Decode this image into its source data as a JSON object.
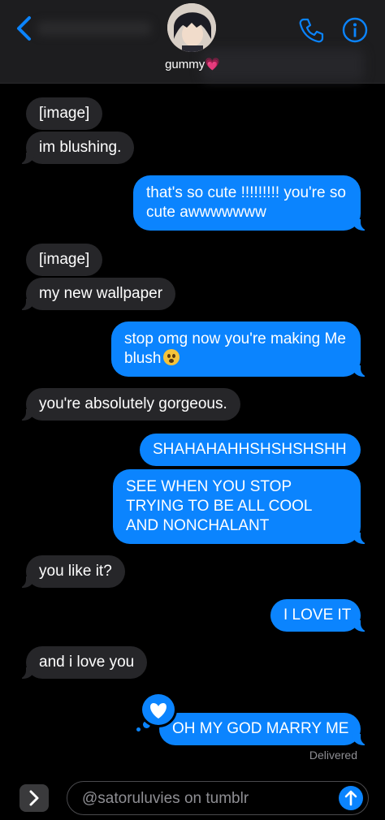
{
  "header": {
    "contact_name": "gummy",
    "contact_emoji": "💗"
  },
  "messages": [
    {
      "side": "in",
      "text": "[image]"
    },
    {
      "side": "in",
      "text": "im blushing."
    },
    {
      "side": "out",
      "text": "that's so cute !!!!!!!!! you're so cute awwwwwww"
    },
    {
      "side": "in",
      "text": "[image]"
    },
    {
      "side": "in",
      "text": "my new wallpaper"
    },
    {
      "side": "out",
      "text": "stop omg now you're making Me blush",
      "emoji": "flushed-face"
    },
    {
      "side": "in",
      "text": "you're absolutely gorgeous."
    },
    {
      "side": "out",
      "text": "SHAHAHAHHSHSHSHSHH"
    },
    {
      "side": "out",
      "text": "SEE WHEN YOU STOP TRYING TO BE ALL COOL AND NONCHALANT"
    },
    {
      "side": "in",
      "text": "you like it?"
    },
    {
      "side": "out",
      "text": "I LOVE IT"
    },
    {
      "side": "in",
      "text": "and i love you"
    },
    {
      "side": "out",
      "text": "OH MY GOD MARRY ME",
      "tapback": "heart-icon"
    }
  ],
  "status": {
    "delivered": "Delivered"
  },
  "composer": {
    "value": "@satoruluvies on tumblr"
  },
  "colors": {
    "accent": "#0b84fe",
    "incoming": "#262629",
    "background": "#000000"
  }
}
